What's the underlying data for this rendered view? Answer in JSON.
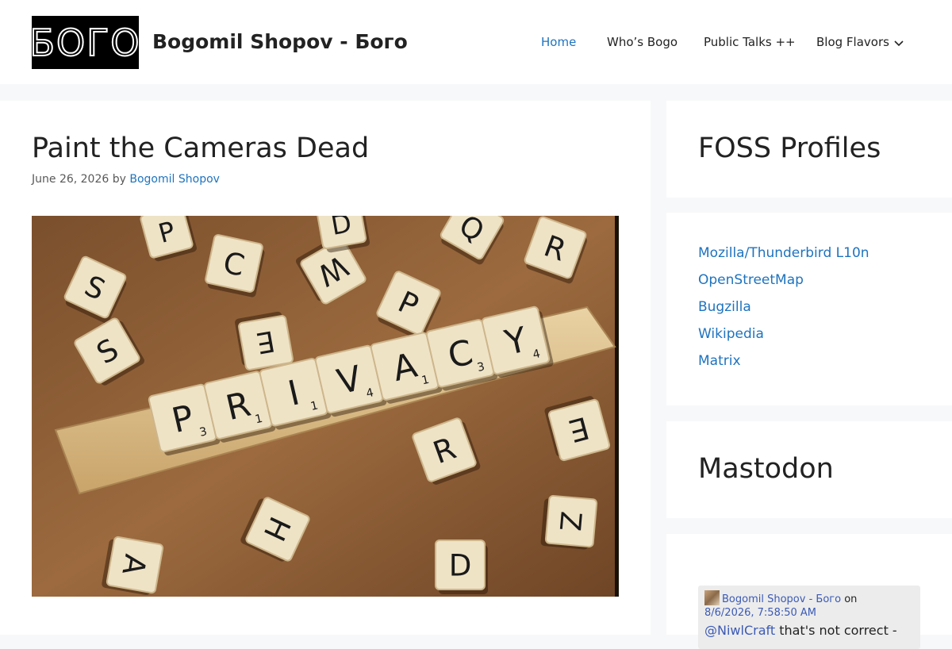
{
  "header": {
    "logo_text": "БОГО",
    "site_title": "Bogomil Shopov - Бого",
    "nav": {
      "home": "Home",
      "who": "Who’s Bogo",
      "talks": "Public Talks ++",
      "flavors": "Blog Flavors"
    }
  },
  "post": {
    "title": "Paint the Cameras Dead",
    "date": "June 26, 2026",
    "by": "by",
    "author": "Bogomil Shopov",
    "image": {
      "rack_tiles": [
        "P",
        "R",
        "I",
        "V",
        "A",
        "C",
        "Y"
      ],
      "rack_scores": [
        "3",
        "1",
        "1",
        "4",
        "1",
        "3",
        "4"
      ],
      "scattered_tiles": [
        "S",
        "P",
        "C",
        "W",
        "D",
        "Q",
        "R",
        "P",
        "S",
        "E",
        "R",
        "E",
        "H",
        "Z",
        "A",
        "D"
      ]
    }
  },
  "sidebar": {
    "foss_title": "FOSS Profiles",
    "foss_links": [
      "Mozilla/Thunderbird L10n",
      "OpenStreetMap",
      "Bugzilla",
      "Wikipedia",
      "Matrix"
    ],
    "mastodon_title": "Mastodon",
    "toot": {
      "author": "Bogomil Shopov - Бого",
      "on": "on",
      "date": "8/6/2026, 7:58:50 AM",
      "mention": "@NiwlCraft",
      "text": " that's not correct -"
    }
  },
  "colors": {
    "link": "#1e73be",
    "background": "#f7f8f9",
    "card": "#ffffff"
  }
}
